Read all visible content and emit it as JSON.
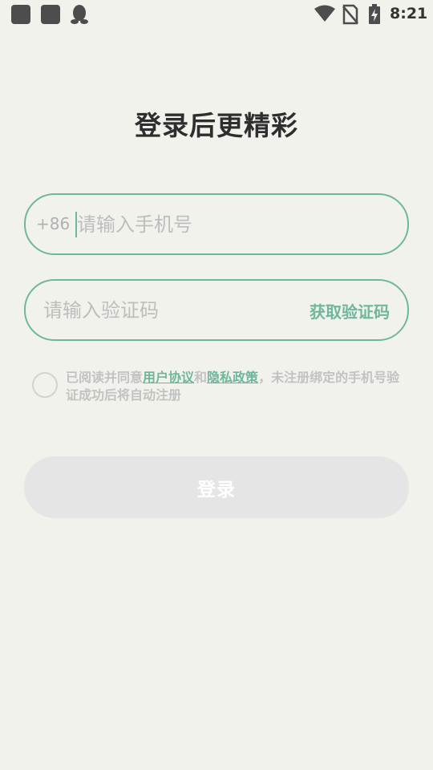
{
  "status_bar": {
    "time": "8:21",
    "icons": [
      "app-icon",
      "app-icon",
      "qq-icon",
      "wifi-icon",
      "no-sim-icon",
      "battery-charging-icon"
    ]
  },
  "title": "登录后更精彩",
  "phone": {
    "country_code": "+86",
    "placeholder": "请输入手机号",
    "value": ""
  },
  "code": {
    "placeholder": "请输入验证码",
    "value": "",
    "get_code_label": "获取验证码"
  },
  "agreement": {
    "prefix": "已阅读并同意",
    "user_agreement": "用户协议",
    "and": "和",
    "privacy_policy": "隐私政策",
    "suffix": "，未注册绑定的手机号验证成功后将自动注册",
    "checked": false
  },
  "login_label": "登录",
  "colors": {
    "accent": "#6fb79c",
    "background": "#f2f2ed",
    "button_disabled": "#e5e5e5"
  }
}
